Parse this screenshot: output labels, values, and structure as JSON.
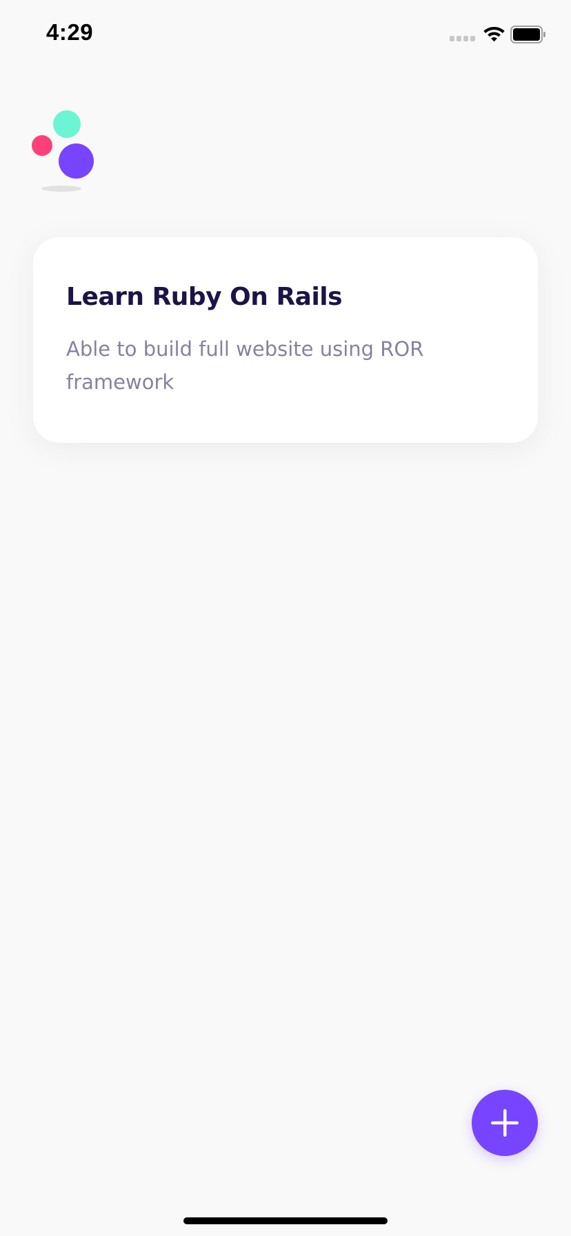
{
  "status_bar": {
    "time": "4:29",
    "signal_icon": "cellular-signal-icon",
    "wifi_icon": "wifi-icon",
    "battery_icon": "battery-icon",
    "battery_level": 1.0
  },
  "logo": {
    "icon": "three-dots-logo",
    "colors": {
      "green": "#6cf5d2",
      "pink": "#ff3f7a",
      "purple": "#7744ff"
    }
  },
  "tasks": [
    {
      "title": "Learn Ruby On Rails",
      "description": "Able to build full website using ROR framework"
    }
  ],
  "fab": {
    "icon": "plus-icon",
    "color": "#7744ff"
  },
  "colors": {
    "background": "#f9f9f9",
    "card": "#ffffff",
    "title": "#1c1446",
    "description": "#85839c"
  }
}
